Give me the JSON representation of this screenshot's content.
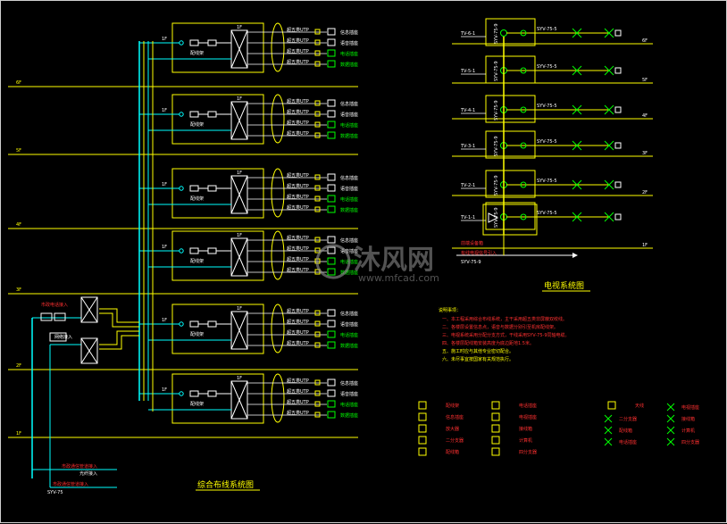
{
  "floors_left": [
    "6F",
    "5F",
    "4F",
    "3F",
    "2F",
    "1F"
  ],
  "floors_right": [
    "6F",
    "5F",
    "4F",
    "3F",
    "2F",
    "1F"
  ],
  "left_diagram": {
    "title": "综合布线系统图",
    "panel_label": "配线架",
    "panel_tag": "1F",
    "outlet_rows": [
      "信息插座",
      "语音插座",
      "电话插座",
      "数据插座"
    ],
    "cable_label": "超五类UTP",
    "inputs": [
      {
        "label": "市政电话接入"
      },
      {
        "label": "网络接入"
      }
    ],
    "bottom_labels": [
      "市政通信管道接入",
      "光纤接入",
      "SYV-75"
    ]
  },
  "right_diagram": {
    "title": "电视系统图",
    "amp_labels": [
      "TV-6-1",
      "TV-5-1",
      "TV-4-1",
      "TV-3-1",
      "TV-2-1",
      "TV-1-1"
    ],
    "cable_label": "SYV-75-5",
    "riser_label": "SYV-75-9",
    "headend_label": "前端设备箱",
    "incoming_label": "有线电视信号引入"
  },
  "notes": {
    "heading": "说明事项：",
    "lines": [
      "一、本工程采用综合布线系统，主干采用超五类非屏蔽双绞线。",
      "二、各楼层设置信息点，语音与数据分别引至机房配线架。",
      "三、电视系统采用分配分支方式，干线采用SYV-75-9同轴电缆。",
      "四、各楼层配线箱安装高度为底边距地1.5米。",
      "五、施工时应与其他专业密切配合。",
      "六、未尽事宜按国家有关规范执行。"
    ]
  },
  "legend": [
    {
      "sym": "rack",
      "label": "配线架"
    },
    {
      "sym": "outlet",
      "label": "信息插座"
    },
    {
      "sym": "amp",
      "label": "放大器"
    },
    {
      "sym": "splitter",
      "label": "二分支器"
    },
    {
      "sym": "panel",
      "label": "配线箱"
    },
    {
      "sym": "phone",
      "label": "电话插座"
    },
    {
      "sym": "tv",
      "label": "电视插座"
    },
    {
      "sym": "box",
      "label": "接线箱"
    },
    {
      "sym": "pc",
      "label": "计算机"
    },
    {
      "sym": "split4",
      "label": "四分支器"
    },
    {
      "sym": "ant",
      "label": "天线"
    }
  ],
  "watermark": {
    "main": "沐风网",
    "sub": "www.mfcad.com"
  }
}
